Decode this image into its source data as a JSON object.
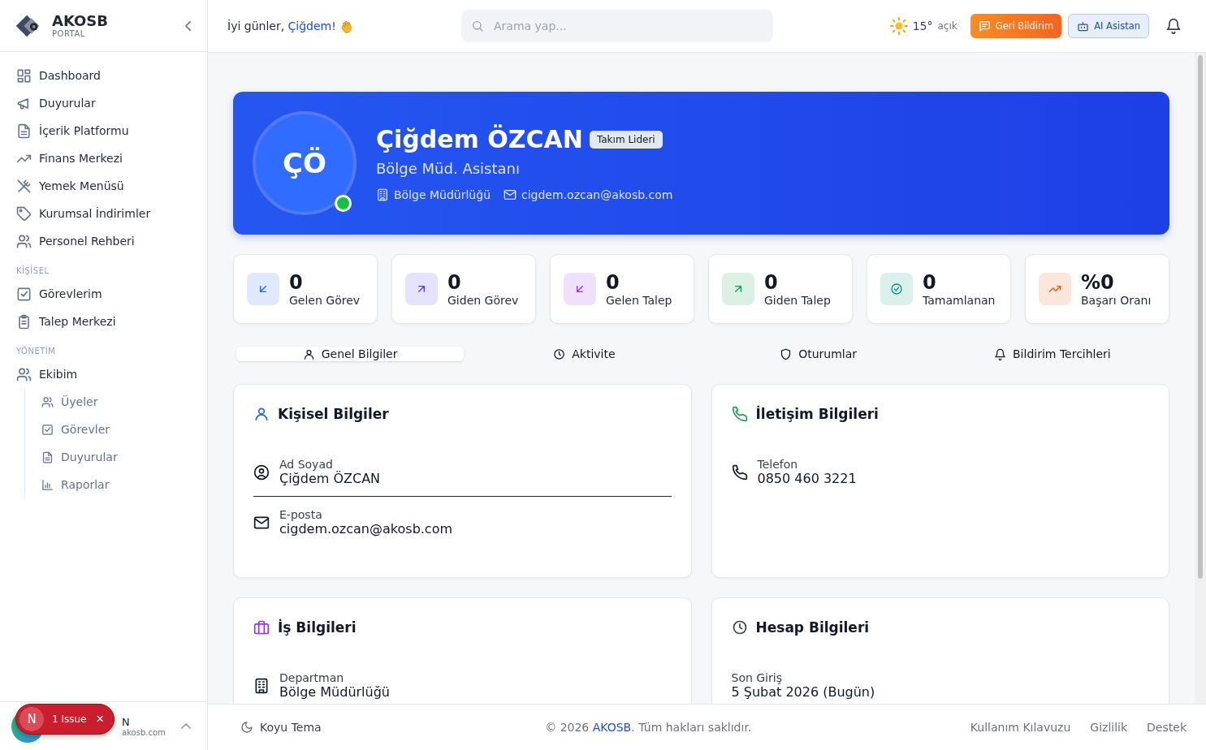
{
  "sidebar": {
    "brand": {
      "name": "AKOSB",
      "subtitle": "PORTAL"
    },
    "groups": [
      {
        "items": [
          {
            "label": "Dashboard",
            "selected": false
          },
          {
            "label": "Duyurular",
            "selected": false
          },
          {
            "label": "İçerik Platformu",
            "selected": false
          },
          {
            "label": "Finans Merkezi",
            "selected": false
          },
          {
            "label": "Yemek Menüsü",
            "selected": false
          },
          {
            "label": "Kurumsal İndirimler",
            "selected": false
          },
          {
            "label": "Personel Rehberi",
            "selected": false
          }
        ]
      },
      {
        "heading": "KİŞİSEL",
        "items": [
          {
            "label": "Görevlerim",
            "selected": false
          },
          {
            "label": "Talep Merkezi",
            "selected": false
          }
        ]
      },
      {
        "heading": "YÖNETİM",
        "items": [
          {
            "label": "Ekibim",
            "selected": false,
            "children": [
              {
                "label": "Üyeler",
                "selected": false
              },
              {
                "label": "Görevler",
                "selected": false
              },
              {
                "label": "Duyurular",
                "selected": false
              },
              {
                "label": "Raporlar",
                "selected": false
              }
            ]
          }
        ]
      }
    ],
    "user": {
      "name": "N",
      "email": "akosb.com"
    }
  },
  "issue_badge": {
    "letter": "N",
    "label": "1 Issue",
    "close": "×"
  },
  "header": {
    "greeting": "İyi günler, ",
    "greeting_name": "Çiğdem!",
    "search": {
      "placeholder": "Arama yap..."
    },
    "weather": {
      "temperature": "15°",
      "condition": "açık"
    },
    "feedback_button": "Geri Bildirim",
    "ai_button": "AI Asistan"
  },
  "profile": {
    "initials": "ÇÖ",
    "online": true,
    "name": "Çiğdem ÖZCAN",
    "badge": "Takım Lideri",
    "title": "Bölge Müd. Asistanı",
    "department": "Bölge Müdürlüğü",
    "email": "cigdem.ozcan@akosb.com"
  },
  "stats": [
    {
      "value": "0",
      "label": "Gelen Görev",
      "color": "#2563eb"
    },
    {
      "value": "0",
      "label": "Giden Görev",
      "color": "#4f46e5"
    },
    {
      "value": "0",
      "label": "Gelen Talep",
      "color": "#9333ea"
    },
    {
      "value": "0",
      "label": "Giden Talep",
      "color": "#16a34a"
    },
    {
      "value": "0",
      "label": "Tamamlanan",
      "color": "#0d9488"
    },
    {
      "value": "%0",
      "label": "Başarı Oranı",
      "color": "#ea580c"
    }
  ],
  "tabs": [
    {
      "label": "Genel Bilgiler",
      "selected": true
    },
    {
      "label": "Aktivite",
      "selected": false
    },
    {
      "label": "Oturumlar",
      "selected": false
    },
    {
      "label": "Bildirim Tercihleri",
      "selected": false
    }
  ],
  "cards": [
    {
      "title": "Kişisel Bilgiler",
      "color": "#2563eb",
      "fields": [
        {
          "label": "Ad Soyad",
          "value": "Çiğdem ÖZCAN"
        },
        {
          "label": "E-posta",
          "value": "cigdem.ozcan@akosb.com"
        }
      ]
    },
    {
      "title": "İletişim Bilgileri",
      "color": "#16a34a",
      "fields": [
        {
          "label": "Telefon",
          "value": "0850 460 3221"
        }
      ]
    },
    {
      "title": "İş Bilgileri",
      "color": "#9333ea",
      "fields": [
        {
          "label": "Departman",
          "value": "Bölge Müdürlüğü"
        }
      ]
    },
    {
      "title": "Hesap Bilgileri",
      "color": "#374151",
      "fields": [
        {
          "label": "Son Giriş",
          "value": "5 Şubat 2026 (Bugün)"
        }
      ]
    }
  ],
  "footer": {
    "theme_toggle": "Koyu Tema",
    "copyright_prefix": "© 2026 ",
    "copyright_link": "AKOSB",
    "copyright_suffix": ". Tüm hakları saklıdır.",
    "links": [
      "Kullanım Kılavuzu",
      "Gizlilik",
      "Destek"
    ]
  }
}
